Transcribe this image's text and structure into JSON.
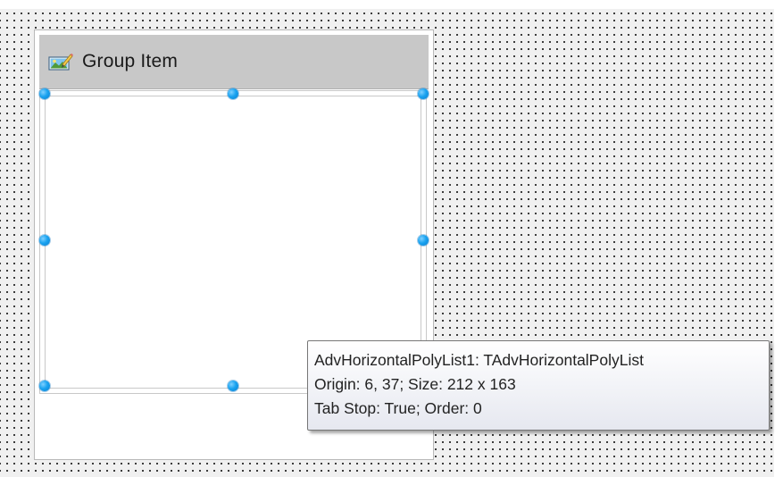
{
  "group_item": {
    "title": "Group Item",
    "icon": "picture-icon"
  },
  "poly_list": {
    "component": "AdvHorizontalPolyList1"
  },
  "tooltip": {
    "line1": "AdvHorizontalPolyList1: TAdvHorizontalPolyList",
    "line2": "Origin: 6, 37; Size: 212 x 163",
    "line3": "Tab Stop: True; Order: 0"
  },
  "colors": {
    "canvas_background": "#f0f0f0",
    "grid_dot": "#202020",
    "header_background": "#c8c8c8",
    "selection_handle": "#1aa3f0",
    "tooltip_border": "#767676"
  }
}
